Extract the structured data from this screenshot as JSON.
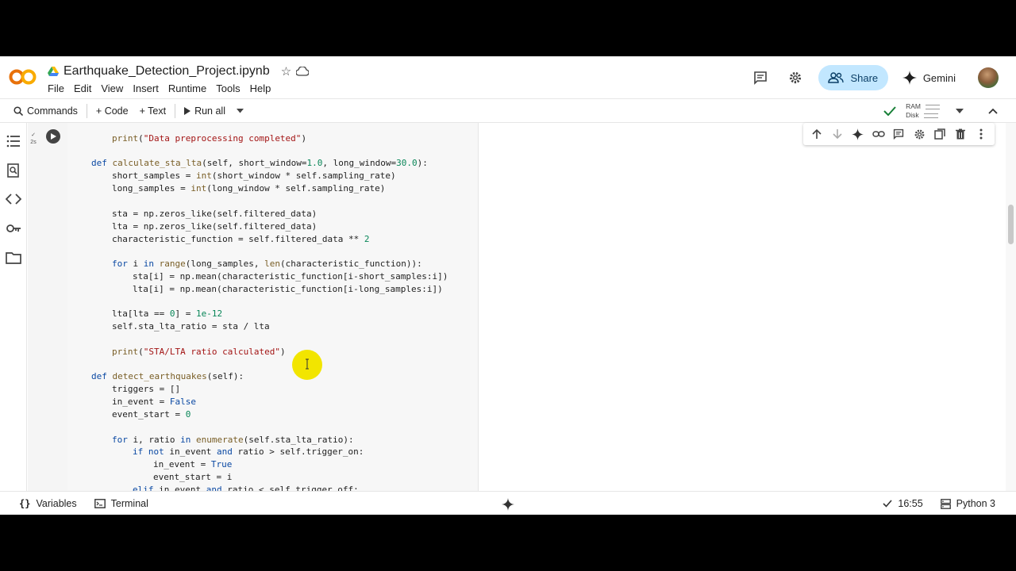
{
  "header": {
    "logo_text": "CO",
    "notebook_title": "Earthquake_Detection_Project.ipynb",
    "menu": [
      "File",
      "Edit",
      "View",
      "Insert",
      "Runtime",
      "Tools",
      "Help"
    ],
    "share_label": "Share",
    "gemini_label": "Gemini"
  },
  "toolbar": {
    "commands_label": "Commands",
    "code_label": "+ Code",
    "text_label": "+ Text",
    "run_all_label": "Run all",
    "ram_label": "RAM",
    "disk_label": "Disk"
  },
  "cell": {
    "exec_time": "2s"
  },
  "code_lines": [
    {
      "t": 12,
      "indent": 1,
      "html": "<span class='fn'>print</span>(<span class='str'>\"Data preprocessing completed\"</span>)"
    },
    {
      "t": 43,
      "indent": 0,
      "html": "<span class='kw'>def</span> <span class='fn'>calculate_sta_lta</span>(self, short_window=<span class='num'>1.0</span>, long_window=<span class='num'>30.0</span>):"
    },
    {
      "t": 59,
      "indent": 1,
      "html": "short_samples = <span class='fn'>int</span>(short_window * self.sampling_rate)"
    },
    {
      "t": 75,
      "indent": 1,
      "html": "long_samples = <span class='fn'>int</span>(long_window * self.sampling_rate)"
    },
    {
      "t": 107,
      "indent": 1,
      "html": "sta = np.zeros_like(self.filtered_data)"
    },
    {
      "t": 123,
      "indent": 1,
      "html": "lta = np.zeros_like(self.filtered_data)"
    },
    {
      "t": 139,
      "indent": 1,
      "html": "characteristic_function = self.filtered_data ** <span class='num'>2</span>"
    },
    {
      "t": 170,
      "indent": 1,
      "html": "<span class='kw'>for</span> i <span class='kw'>in</span> <span class='fn'>range</span>(long_samples, <span class='fn'>len</span>(characteristic_function)):"
    },
    {
      "t": 186,
      "indent": 2,
      "html": "sta[i] = np.mean(characteristic_function[i-short_samples:i])"
    },
    {
      "t": 202,
      "indent": 2,
      "html": "lta[i] = np.mean(characteristic_function[i-long_samples:i])"
    },
    {
      "t": 233,
      "indent": 1,
      "html": "lta[lta == <span class='num'>0</span>] = <span class='num'>1e-12</span>"
    },
    {
      "t": 249,
      "indent": 1,
      "html": "self.sta_lta_ratio = sta / lta"
    },
    {
      "t": 281,
      "indent": 1,
      "html": "<span class='fn'>print</span>(<span class='str'>\"STA/LTA ratio calculated\"</span>)"
    },
    {
      "t": 312,
      "indent": 0,
      "html": "<span class='kw'>def</span> <span class='fn'>detect_earthquakes</span>(self):"
    },
    {
      "t": 328,
      "indent": 1,
      "html": "triggers = []"
    },
    {
      "t": 344,
      "indent": 1,
      "html": "in_event = <span class='kw'>False</span>"
    },
    {
      "t": 360,
      "indent": 1,
      "html": "event_start = <span class='num'>0</span>"
    },
    {
      "t": 392,
      "indent": 1,
      "html": "<span class='kw'>for</span> i, ratio <span class='kw'>in</span> <span class='fn'>enumerate</span>(self.sta_lta_ratio):"
    },
    {
      "t": 407,
      "indent": 2,
      "html": "<span class='kw'>if</span> <span class='kw'>not</span> in_event <span class='kw'>and</span> ratio &gt; self.trigger_on:"
    },
    {
      "t": 423,
      "indent": 3,
      "html": "in_event = <span class='kw'>True</span>"
    },
    {
      "t": 439,
      "indent": 3,
      "html": "event_start = i"
    },
    {
      "t": 455,
      "indent": 2,
      "html": "<span class='kw'>elif</span> in_event <span class='kw'>and</span> ratio &lt; self.trigger_off:"
    }
  ],
  "status": {
    "variables_label": "Variables",
    "terminal_label": "Terminal",
    "time": "16:55",
    "runtime_label": "Python 3"
  }
}
